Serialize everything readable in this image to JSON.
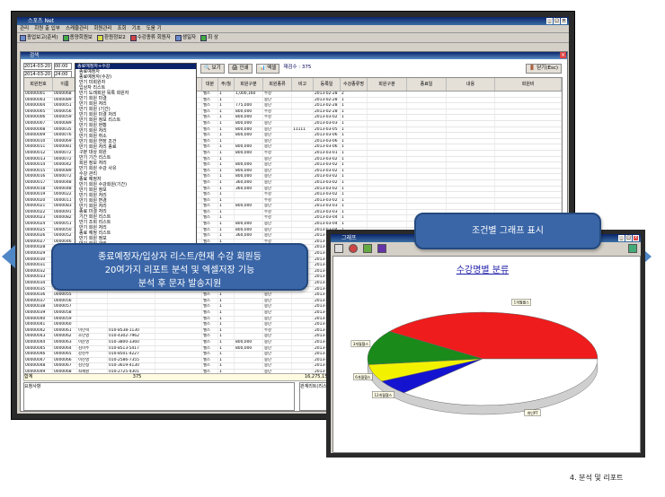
{
  "main_window": {
    "title": "스포츠 Net",
    "menu": [
      "관리",
      "회원 출 입부",
      "스케줄관리",
      "회원관리",
      "조회",
      "기초",
      "도움 기"
    ],
    "toolbar": [
      "종업보고(준비)",
      "종양회원보",
      "환원정보2",
      "수강종류 회원자",
      "생일자",
      "회 상"
    ],
    "form_title": "검색",
    "date_from": "2014-03-20",
    "date_to": "2014-03-20",
    "time_from": "00:00",
    "time_to": "24:00",
    "dropdown_selected": "종료예정자+수강",
    "dropdown_items": [
      "종료예정자",
      "종료예정자(수강)",
      "만기 미회원자",
      "입상자 리스트",
      "만기 도래회원 목록 회원자",
      "만기 회원 미결",
      "만기 회원 처리",
      "만기 회원 (기간)",
      "만기 회원 미결 처리",
      "만기 회원 정보 리스트",
      "만기 회원 현황",
      "만기 회원 처리",
      "만기 회원 취소",
      "만기 회원 연장 조건",
      "만기 회원 처리 종료",
      "구분 대상 회원",
      "만기 기간 리스트",
      "회원 정보 처리",
      "만기 회원 수강 사유",
      "수강 관리",
      "종료 예정자",
      "만기 회원 수강회원(기간)",
      "만기 회원 정보",
      "만기 회원 처리",
      "만기 회원 변경",
      "만기 회원 처리",
      "종료 미결 처리",
      "기간 회원 리스트",
      "만기 조회 리스트",
      "만기 회원 처리",
      "종료 예정 리스트",
      "만기 회원 정보",
      "만기 회원 관리",
      "미수 회원 (미수금)",
      "만기 회원 (입실통계)",
      "만기 정보 회원",
      "만기 조회 정보",
      "종료 회원 처리",
      "회원 처리 완료",
      "미결 정보 리스트",
      "만기 리스트 (수강별)",
      "만기 회원 처리 등록"
    ],
    "buttons": {
      "view": "보기",
      "print": "인쇄",
      "excel": "엑셀",
      "close": "닫기(Esc)"
    },
    "record_count": "재검수 : 375",
    "columns": [
      "회원번호",
      "이름",
      "전화",
      "휴대폰",
      "회원분류",
      "대분",
      "주/월",
      "회원구분",
      "회원종류",
      "비고",
      "등록일",
      "수강종류명",
      "회원구분",
      "종료일",
      "내용",
      "회원비"
    ],
    "rows": [
      [
        "00000001",
        "0000068",
        "",
        "",
        "",
        "헬스",
        "1",
        "1,000,160",
        "수강",
        "",
        "2013-02-28",
        "2"
      ],
      [
        "00000003",
        "0000089",
        "",
        "",
        "",
        "헬스",
        "1",
        "",
        "중단",
        "",
        "2013-02-28",
        "1"
      ],
      [
        "00000004",
        "0000051",
        "",
        "",
        "",
        "헬스",
        "1",
        "775,000",
        "중단",
        "",
        "2013-02-28",
        "1"
      ],
      [
        "00000005",
        "0000056",
        "",
        "",
        "",
        "헬스",
        "1",
        "800,000",
        "수강",
        "",
        "2013-02-28",
        "1"
      ],
      [
        "00000006",
        "0000059",
        "",
        "",
        "",
        "헬스",
        "1",
        "800,000",
        "수강",
        "",
        "2013-03-02",
        "1"
      ],
      [
        "00000007",
        "0000089",
        "",
        "",
        "",
        "헬스",
        "1",
        "800,000",
        "중단",
        "",
        "2013-03-03",
        "1"
      ],
      [
        "00000008",
        "0000035",
        "",
        "",
        "",
        "헬스",
        "1",
        "800,000",
        "중단",
        "11111",
        "2013-03-05",
        "1"
      ],
      [
        "00000009",
        "0000076",
        "",
        "",
        "",
        "헬스",
        "1",
        "800,000",
        "중단",
        "",
        "2013-03-06",
        "1"
      ],
      [
        "00000010",
        "0000069",
        "",
        "",
        "",
        "헬스",
        "1",
        "",
        "중단",
        "",
        "2013-03-06",
        "1"
      ],
      [
        "00000011",
        "0000081",
        "",
        "",
        "",
        "헬스",
        "1",
        "800,000",
        "중단",
        "",
        "2013-03-06",
        "1"
      ],
      [
        "00000012",
        "0000072",
        "",
        "",
        "",
        "헬스",
        "1",
        "800,000",
        "수강",
        "",
        "2013-03-01",
        "1"
      ],
      [
        "00000013",
        "0000072",
        "",
        "",
        "",
        "헬스",
        "1",
        "",
        "중단",
        "",
        "2013-03-02",
        "1"
      ],
      [
        "00000014",
        "0000042",
        "",
        "",
        "",
        "헬스",
        "1",
        "800,000",
        "중단",
        "",
        "2013-03-02",
        "1"
      ],
      [
        "00000015",
        "0000089",
        "",
        "",
        "",
        "헬스",
        "1",
        "800,000",
        "중단",
        "",
        "2013-03-02",
        "1"
      ],
      [
        "00000016",
        "0000072",
        "",
        "",
        "",
        "헬스",
        "1",
        "800,000",
        "중단",
        "",
        "2013-03-02",
        "1"
      ],
      [
        "00000017",
        "0000048",
        "",
        "",
        "",
        "헬스",
        "1",
        "360,000",
        "중단",
        "",
        "2013-03-02",
        "1"
      ],
      [
        "00000018",
        "0000048",
        "",
        "",
        "",
        "헬스",
        "1",
        "360,000",
        "중단",
        "",
        "2013-03-02",
        "1"
      ],
      [
        "00000019",
        "0000022",
        "",
        "",
        "",
        "헬스",
        "1",
        "",
        "수강",
        "",
        "2013-03-02",
        "1"
      ],
      [
        "00000020",
        "0000011",
        "",
        "",
        "",
        "헬스",
        "1",
        "",
        "수강",
        "",
        "2013-03-02",
        "1"
      ],
      [
        "00000021",
        "0000083",
        "",
        "",
        "",
        "헬스",
        "1",
        "800,000",
        "중단",
        "",
        "2013-03-03",
        "1"
      ],
      [
        "00000022",
        "0000091",
        "",
        "",
        "",
        "헬스",
        "1",
        "",
        "수강",
        "",
        "2013-03-03",
        "1"
      ],
      [
        "00000023",
        "0000082",
        "",
        "",
        "",
        "헬스",
        "1",
        "",
        "수강",
        "",
        "2013-03-04",
        "1"
      ],
      [
        "00000024",
        "0000051",
        "",
        "",
        "",
        "헬스",
        "1",
        "800,000",
        "중단",
        "",
        "2013-03-04",
        "1"
      ],
      [
        "00000025",
        "0000050",
        "",
        "",
        "",
        "헬스",
        "1",
        "800,000",
        "중단",
        "",
        "2013-03-04",
        "1"
      ],
      [
        "00000026",
        "0000052",
        "",
        "",
        "",
        "헬스",
        "1",
        "360,000",
        "중단",
        "",
        "2013-03-04",
        "1"
      ],
      [
        "00000027",
        "0000046",
        "이승준",
        "010-7509-2917",
        "",
        "헬스",
        "1",
        "",
        "수강",
        "",
        "2013-03-04",
        "1"
      ],
      [
        "00000028",
        "0000047",
        "정선영",
        "010-6676-4332",
        "",
        "헬스",
        "1",
        "",
        "수강",
        "",
        "2013-03-05",
        "1"
      ],
      [
        "00000029",
        "0000048",
        "한동호",
        "010-4800-2191",
        "",
        "헬스",
        "1",
        "360,000",
        "중단",
        "",
        "2013-03-05",
        "1"
      ],
      [
        "00000030",
        "0000049",
        "",
        "",
        "",
        "헬스",
        "1",
        "",
        "중단",
        "",
        "2013-03-05",
        "1"
      ],
      [
        "00000031",
        "0000050",
        "",
        "",
        "",
        "헬스",
        "1",
        "",
        "중단",
        "",
        "2013-03-05",
        "1"
      ],
      [
        "00000032",
        "0000051",
        "",
        "",
        "",
        "헬스",
        "1",
        "",
        "중단",
        "",
        "2013-03-05",
        "1"
      ],
      [
        "00000033",
        "0000052",
        "",
        "",
        "",
        "헬스",
        "1",
        "",
        "중단",
        "",
        "2013-03-06",
        "1"
      ],
      [
        "00000034",
        "0000053",
        "",
        "",
        "",
        "헬스",
        "1",
        "",
        "중단",
        "",
        "2013-03-06",
        "1"
      ],
      [
        "00000035",
        "0000054",
        "",
        "",
        "",
        "헬스",
        "1",
        "",
        "중단",
        "",
        "2013-03-06",
        "1"
      ],
      [
        "00000036",
        "0000055",
        "",
        "",
        "",
        "헬스",
        "1",
        "",
        "중단",
        "",
        "2013-03-06",
        "1"
      ],
      [
        "00000037",
        "0000056",
        "",
        "",
        "",
        "헬스",
        "1",
        "",
        "중단",
        "",
        "2013-03-06",
        "1"
      ],
      [
        "00000038",
        "0000057",
        "",
        "",
        "",
        "헬스",
        "1",
        "",
        "중단",
        "",
        "2013-03-06",
        "1"
      ],
      [
        "00000039",
        "0000058",
        "",
        "",
        "",
        "헬스",
        "1",
        "",
        "중단",
        "",
        "2013-03-07",
        "1"
      ],
      [
        "00000040",
        "0000059",
        "",
        "",
        "",
        "헬스",
        "1",
        "",
        "중단",
        "",
        "2013-03-07",
        "1"
      ],
      [
        "00000041",
        "0000060",
        "",
        "",
        "",
        "헬스",
        "1",
        "",
        "중단",
        "",
        "2013-03-07",
        "1"
      ],
      [
        "00000042",
        "0000061",
        "이민혁",
        "010-8538-1130",
        "",
        "헬스",
        "1",
        "",
        "수강",
        "",
        "2013-03-07",
        "1"
      ],
      [
        "00000043",
        "0000062",
        "조민영",
        "010-4302-7962",
        "",
        "헬스",
        "1",
        "",
        "중단",
        "",
        "2013-03-07",
        "1"
      ],
      [
        "00000044",
        "0000063",
        "이순영",
        "010-3800-3360",
        "",
        "헬스",
        "1",
        "800,000",
        "중단",
        "",
        "2013-03-08",
        "1"
      ],
      [
        "00000045",
        "0000064",
        "김미주",
        "010-8513-5417",
        "",
        "헬스",
        "1",
        "800,000",
        "중단",
        "",
        "2013-03-08",
        "1"
      ],
      [
        "00000046",
        "0000065",
        "강현주",
        "010-8501-4227",
        "",
        "헬스",
        "1",
        "",
        "중단",
        "",
        "2013-03-08",
        "1"
      ],
      [
        "00000047",
        "0000066",
        "이진영",
        "010-2586-7355",
        "",
        "헬스",
        "1",
        "",
        "중단",
        "",
        "2013-03-08",
        "1"
      ],
      [
        "00000048",
        "0000067",
        "김민정",
        "010-3619-4130",
        "",
        "헬스",
        "1",
        "",
        "중단",
        "",
        "2013-03-09",
        "1"
      ],
      [
        "00000049",
        "0000068",
        "최혜원",
        "010-2725-4301",
        "",
        "헬스",
        "1",
        "",
        "중단",
        "",
        "2013-03-09",
        "1"
      ],
      [
        "00000050",
        "0000069",
        "김지민",
        "010-8523-3965",
        "",
        "헬스",
        "1",
        "",
        "중단",
        "",
        "2013-03-09",
        "1"
      ],
      [
        "00000051",
        "0000070",
        "정영민",
        "010-5340-1657",
        "",
        "헬스",
        "1",
        "",
        "중단",
        "",
        "2013-03-09",
        "1"
      ],
      [
        "00000052",
        "0000071",
        "윤지현",
        "010-5775-4616",
        "",
        "헬스",
        "1",
        "1,000,160",
        "수강",
        "",
        "2013-03-10",
        "1"
      ]
    ],
    "sum_label": "합계",
    "sum_count": "375",
    "sum_amount": "16,275,150",
    "note_label": "요청사항",
    "note2_label": "관계리트(리스트)"
  },
  "callouts": {
    "left_lines": [
      "종료예정자/입상자 리스트/현재 수강 회원등",
      "20여가지 리포트 분석 및 엑셀저장 기능",
      "분석 후 문자 발송지원"
    ],
    "right": "조건별 그래프 표시"
  },
  "graph_window": {
    "title": "그래프"
  },
  "chart_data": {
    "type": "pie",
    "title": "수강명별 분류",
    "slices": [
      {
        "label": "1개월헬스",
        "value": 40,
        "color": "#ee1c1c"
      },
      {
        "label": "3개월헬스",
        "value": 12,
        "color": "#1a8a1a"
      },
      {
        "label": "6개월헬스",
        "value": 6,
        "color": "#f2f200"
      },
      {
        "label": "12개월헬스",
        "value": 5,
        "color": "#1414d0"
      },
      {
        "label": "개인PT",
        "value": 37,
        "color": "#ffffff"
      }
    ],
    "slice_tags": [
      "1개월헬스",
      "3개월헬스",
      "6개월헬스",
      "12개월헬스",
      "개인PT",
      "요가(1)",
      "필라테스"
    ]
  },
  "caption": "4. 분석 및 리포트"
}
